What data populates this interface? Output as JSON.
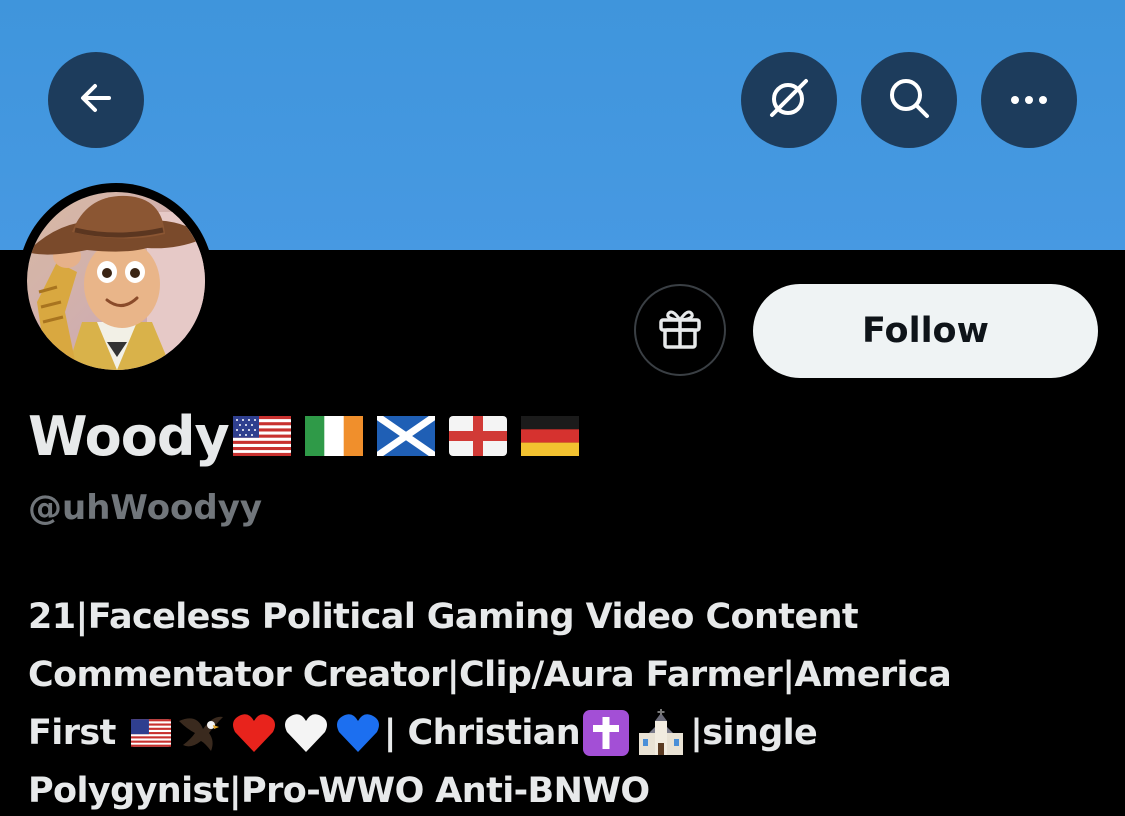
{
  "header": {
    "back_icon": "arrow-left-icon",
    "grok_icon": "grok-icon",
    "search_icon": "search-icon",
    "more_icon": "more-horizontal-icon",
    "banner_color": "#4598df"
  },
  "profile": {
    "display_name": "Woody",
    "name_emojis": [
      "flag-us",
      "flag-ireland",
      "flag-scotland",
      "flag-england",
      "flag-germany"
    ],
    "handle": "@uhWoodyy",
    "avatar": "woody-toy-story-avatar",
    "gift_icon": "gift-icon",
    "follow_label": "Follow",
    "bio": {
      "line1": "21|Faceless Political Gaming Video Content",
      "line2": "Commentator Creator|Clip/Aura Farmer|America",
      "line3a": "First",
      "line3_emojis": [
        "flag-us",
        "eagle",
        "red-heart",
        "white-heart",
        "blue-heart"
      ],
      "line3b": "| Christian",
      "line3_emojis2": [
        "latin-cross",
        "church"
      ],
      "line3c": "|single",
      "line4": "Polygynist|Pro-WWO Anti-BNWO"
    }
  }
}
